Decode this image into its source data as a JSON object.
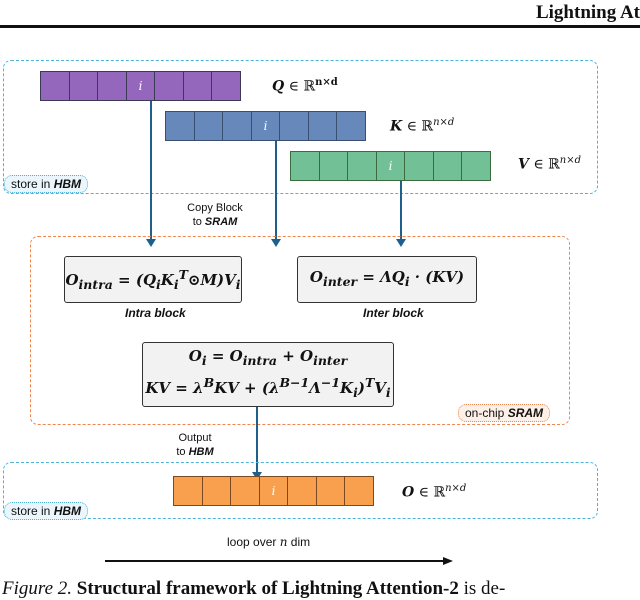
{
  "header": {
    "title": "Lightning At"
  },
  "regions": {
    "hbm_top_tag": {
      "prefix": "store in ",
      "bold": "HBM"
    },
    "sram_tag": {
      "prefix": "on-chip ",
      "bold": "SRAM"
    },
    "hbm_bottom_tag": {
      "prefix": "store in ",
      "bold": "HBM"
    }
  },
  "colors": {
    "q": "#9467bd",
    "q_border": "#3a3a55",
    "k": "#6688bb",
    "k_border": "#3a4f70",
    "v": "#72c096",
    "v_border": "#3c6b3f",
    "o": "#f9a04f",
    "o_border": "#7a4a22",
    "hbm_border": "#4fb2d9",
    "sram_border": "#f0864e",
    "arrow": "#1f5f8b"
  },
  "matrices": [
    {
      "id": "q",
      "symbol": "Q",
      "label_rest": " ∈ ℝ",
      "sup": "n×d",
      "cells": [
        "",
        "",
        "",
        "i",
        "",
        "",
        ""
      ]
    },
    {
      "id": "k",
      "symbol": "K",
      "label_rest": " ∈ ℝ",
      "sup": "n×d",
      "cells": [
        "",
        "",
        "",
        "i",
        "",
        "",
        ""
      ]
    },
    {
      "id": "v",
      "symbol": "V",
      "label_rest": " ∈ ℝ",
      "sup": "n×d",
      "cells": [
        "",
        "",
        "",
        "i",
        "",
        "",
        ""
      ]
    },
    {
      "id": "o",
      "symbol": "O",
      "label_rest": " ∈ ℝ",
      "sup": "n×d",
      "cells": [
        "",
        "",
        "",
        "i",
        "",
        "",
        ""
      ]
    }
  ],
  "captions": {
    "copy_line1": "Copy Block",
    "copy_line2_prefix": "to ",
    "copy_line2_bold": "SRAM",
    "output_line1": "Output",
    "output_line2_prefix": "to ",
    "output_line2_bold": "HBM"
  },
  "formulas": {
    "intra": "O_intra = (Q_i K_i^T ⊙ M) V_i",
    "inter": "O_inter = ΛQ_i · (KV)",
    "combine": "O_i = O_intra + O_inter",
    "kv_update": "KV = λ^B KV + (λ^(B−1) Λ^(−1) K_i)^T V_i"
  },
  "block_labels": {
    "intra": "Intra block",
    "inter": "Inter block"
  },
  "loop": {
    "prefix": "loop over ",
    "var": "n",
    "suffix": " dim"
  },
  "figure_caption": {
    "prefix": "Figure 2.",
    "bold": " Structural framework of Lightning Attention-2",
    "rest": " is de-"
  }
}
